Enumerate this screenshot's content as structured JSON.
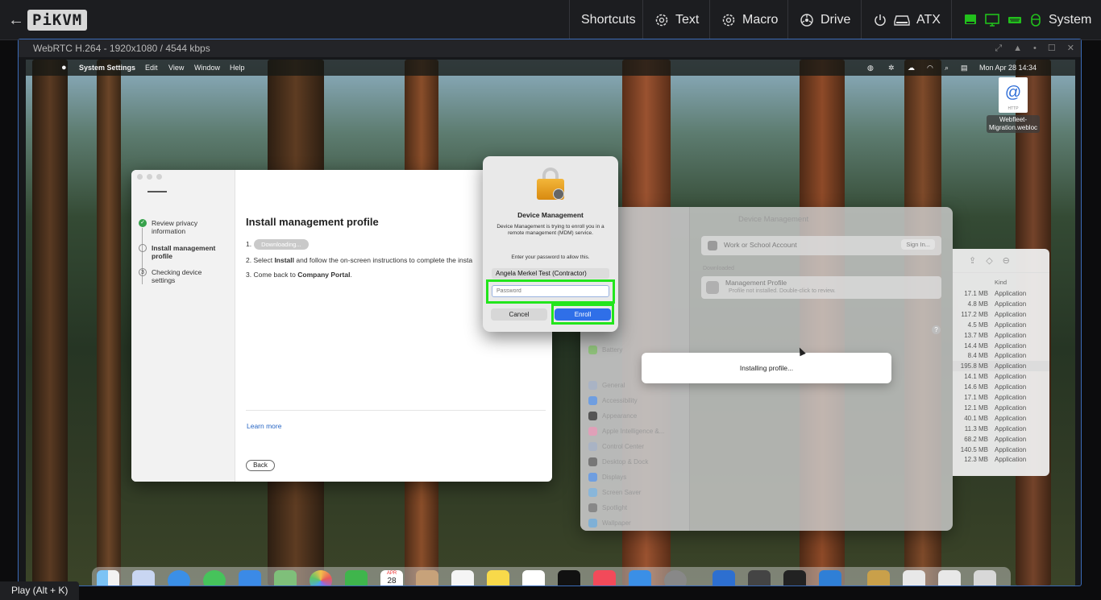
{
  "kvm": {
    "back_glyph": "←",
    "logo": "PiKVM",
    "menu": {
      "shortcuts": "Shortcuts",
      "text": "Text",
      "macro": "Macro",
      "drive": "Drive",
      "atx": "ATX",
      "system": "System"
    },
    "accent_color": "#22e51c"
  },
  "stream": {
    "title": "WebRTC H.264 - 1920x1080 / 4544 kbps",
    "controls": [
      "⤢",
      "▲",
      "•",
      "☐",
      "✕"
    ]
  },
  "menubar": {
    "app": "System Settings",
    "items": [
      "Edit",
      "View",
      "Window",
      "Help"
    ],
    "clock": "Mon Apr 28  14:34"
  },
  "desktop_file": {
    "name_line1": "Webfleet-",
    "name_line2": "Migration.webloc",
    "badge": "HTTP"
  },
  "company_portal": {
    "steps": [
      {
        "label": "Review privacy information",
        "state": "done"
      },
      {
        "label": "Install management profile",
        "state": "current"
      },
      {
        "label": "Checking device settings",
        "state": "pending",
        "number": "3"
      }
    ],
    "title": "Install management profile",
    "line1_prefix": "1.",
    "line1_pill": "Downloading...",
    "line2_prefix": "2. Select ",
    "line2_bold": "Install",
    "line2_suffix": " and follow the on-screen instructions to complete the insta",
    "line3_prefix": "3. Come back to ",
    "line3_bold": "Company Portal",
    "line3_suffix": ".",
    "learn_more": "Learn more",
    "back": "Back"
  },
  "system_settings": {
    "header": "Device Management",
    "work_account": "Work or School Account",
    "sign_in": "Sign In...",
    "downloaded_label": "Downloaded",
    "profile_name": "Management Profile",
    "profile_status": "Profile not installed. Double-click to review.",
    "help_glyph": "?",
    "sidebar": [
      "Battery",
      "General",
      "Accessibility",
      "Appearance",
      "Apple Intelligence &...",
      "Control Center",
      "Desktop & Dock",
      "Displays",
      "Screen Saver",
      "Spotlight",
      "Wallpaper"
    ]
  },
  "finder": {
    "kind_header": "Kind",
    "rows": [
      {
        "size": "17.1 MB",
        "kind": "Application"
      },
      {
        "size": "4.8 MB",
        "kind": "Application"
      },
      {
        "size": "117.2 MB",
        "kind": "Application"
      },
      {
        "size": "4.5 MB",
        "kind": "Application"
      },
      {
        "size": "13.7 MB",
        "kind": "Application"
      },
      {
        "size": "14.4 MB",
        "kind": "Application"
      },
      {
        "size": "8.4 MB",
        "kind": "Application"
      },
      {
        "size": "195.8 MB",
        "kind": "Application"
      },
      {
        "size": "14.1 MB",
        "kind": "Application"
      },
      {
        "size": "14.6 MB",
        "kind": "Application"
      },
      {
        "size": "17.1 MB",
        "kind": "Application"
      },
      {
        "size": "12.1 MB",
        "kind": "Application"
      },
      {
        "size": "40.1 MB",
        "kind": "Application"
      },
      {
        "size": "11.3 MB",
        "kind": "Application"
      },
      {
        "size": "68.2 MB",
        "kind": "Application"
      },
      {
        "size": "140.5 MB",
        "kind": "Application"
      },
      {
        "size": "12.3 MB",
        "kind": "Application"
      }
    ]
  },
  "toast": {
    "text": "Installing profile..."
  },
  "auth_dialog": {
    "title": "Device Management",
    "message": "Device Management is trying to enroll you in a remote management (MDM) service.",
    "prompt": "Enter your password to allow this.",
    "username": "Angela Merkel Test (Contractor)",
    "password_placeholder": "Password",
    "cancel": "Cancel",
    "enroll": "Enroll"
  },
  "dock": {
    "calendar_month": "APR",
    "calendar_day": "28"
  },
  "tooltip": {
    "text": "Play (Alt + K)"
  }
}
